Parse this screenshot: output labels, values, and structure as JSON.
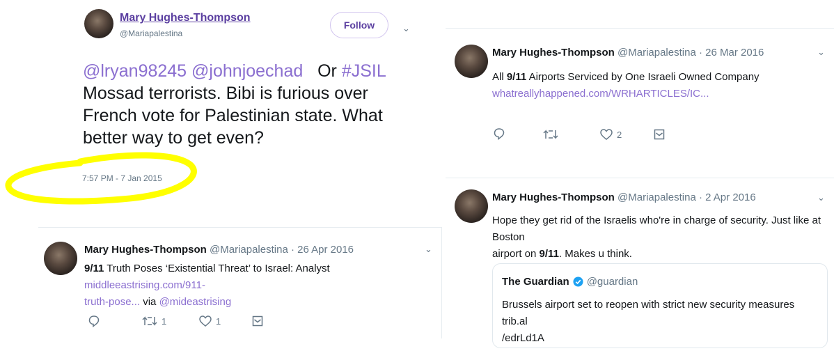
{
  "colors": {
    "highlight": "#ffff00",
    "link": "#8b6fd0",
    "muted": "#657786"
  },
  "main_tweet": {
    "name": "Mary Hughes-Thompson",
    "handle": "@Mariapalestina",
    "follow_label": "Follow",
    "mention1": "@lryan98245",
    "mention2": "@johnjoechad",
    "or_text": "Or",
    "hashtag": "#JSIL",
    "body_rest": "Mossad terrorists. Bibi is furious over French vote for Palestinian state. What better way to get even?",
    "timestamp": "7:57 PM - 7 Jan 2015"
  },
  "tweet_bl": {
    "name": "Mary Hughes-Thompson",
    "meta": "@Mariapalestina · 26 Apr 2016",
    "bold_prefix": "9/11",
    "text": "Truth Poses ‘Existential Threat’ to Israel: Analyst",
    "link1": "middleeastrising.com/911-",
    "link2": "truth-pose...",
    "via": "via",
    "via_handle": "@mideastrising",
    "retweets": "1",
    "likes": "1"
  },
  "tweet_tr": {
    "name": "Mary Hughes-Thompson",
    "meta": "@Mariapalestina · 26 Mar 2016",
    "text_pre": "All",
    "bold": "9/11",
    "text_post": "Airports Serviced by One Israeli Owned Company",
    "link": "whatreallyhappened.com/WRHARTICLES/IC...",
    "likes": "2"
  },
  "tweet_br": {
    "name": "Mary Hughes-Thompson",
    "meta": "@Mariapalestina · 2 Apr 2016",
    "line1": "Hope they get rid of the Israelis who're in charge of security.  Just like at Boston",
    "line2_pre": "airport on",
    "line2_bold": "9/11",
    "line2_post": ". Makes u think.",
    "quote": {
      "name": "The Guardian",
      "handle": "@guardian",
      "line1": "Brussels airport set to reopen with strict new security measures trib.al",
      "line2": "/edrLd1A"
    }
  },
  "icons": [
    "reply-icon",
    "retweet-icon",
    "like-icon",
    "dm-icon",
    "chevron-down-icon",
    "verified-icon"
  ]
}
